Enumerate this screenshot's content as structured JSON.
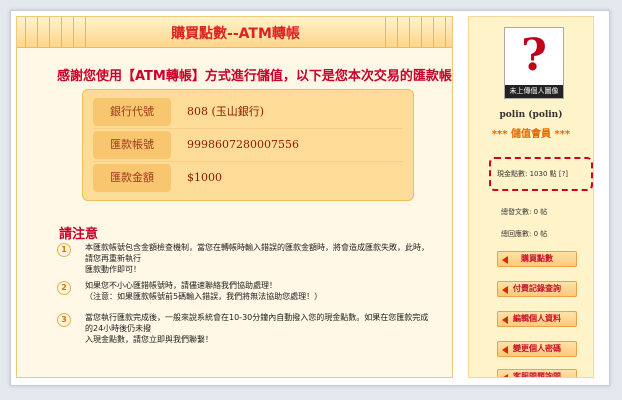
{
  "page": {
    "title": "購買點數--ATM轉帳",
    "intro": "感謝您使用【ATM轉帳】方式進行儲值，以下是您本次交易的匯款帳號："
  },
  "transfer": {
    "rows": [
      {
        "label": "銀行代號",
        "value": "808 (玉山銀行)"
      },
      {
        "label": "匯款帳號",
        "value": "9998607280007556"
      },
      {
        "label": "匯款金額",
        "value": "$1000"
      }
    ]
  },
  "notes": {
    "title": "請注意",
    "items": [
      {
        "num": "1",
        "lines": [
          "本匯款帳號包含金額檢查機制，當您在轉帳時輸入錯誤的匯款金額時，將會造成匯款失敗，此時，",
          "請您再重新執行",
          "匯款動作即可！"
        ]
      },
      {
        "num": "2",
        "lines": [
          "如果您不小心匯錯帳號時，請儘速聯絡我們協助處理！",
          "（注意：如果匯款帳號前5碼輸入錯誤，我們將無法協助您處理！）"
        ]
      },
      {
        "num": "3",
        "lines": [
          "當您執行匯款完成後，一般來說系統會在10-30分鐘內自動撥入您的現金點數。如果在您匯款完成",
          "的24小時後仍未撥",
          "入現金點數，請您立即與我們聯繫！"
        ]
      }
    ]
  },
  "sidebar": {
    "avatar_caption": "未上傳個人圖像",
    "avatar_symbol": "?",
    "username": "polin (polin)",
    "role": "*** 儲值會員 ***",
    "points_text": "現金點數: 1030 點 [?]",
    "posts_text": "總發文數: 0 帖",
    "replies_text": "總回應數: 0 帖",
    "buttons": [
      "購買點數",
      "付費記錄查詢",
      "編輯個人資料",
      "變更個人密碼",
      "客服問題詢問"
    ],
    "accent_color": "#c8102e"
  }
}
